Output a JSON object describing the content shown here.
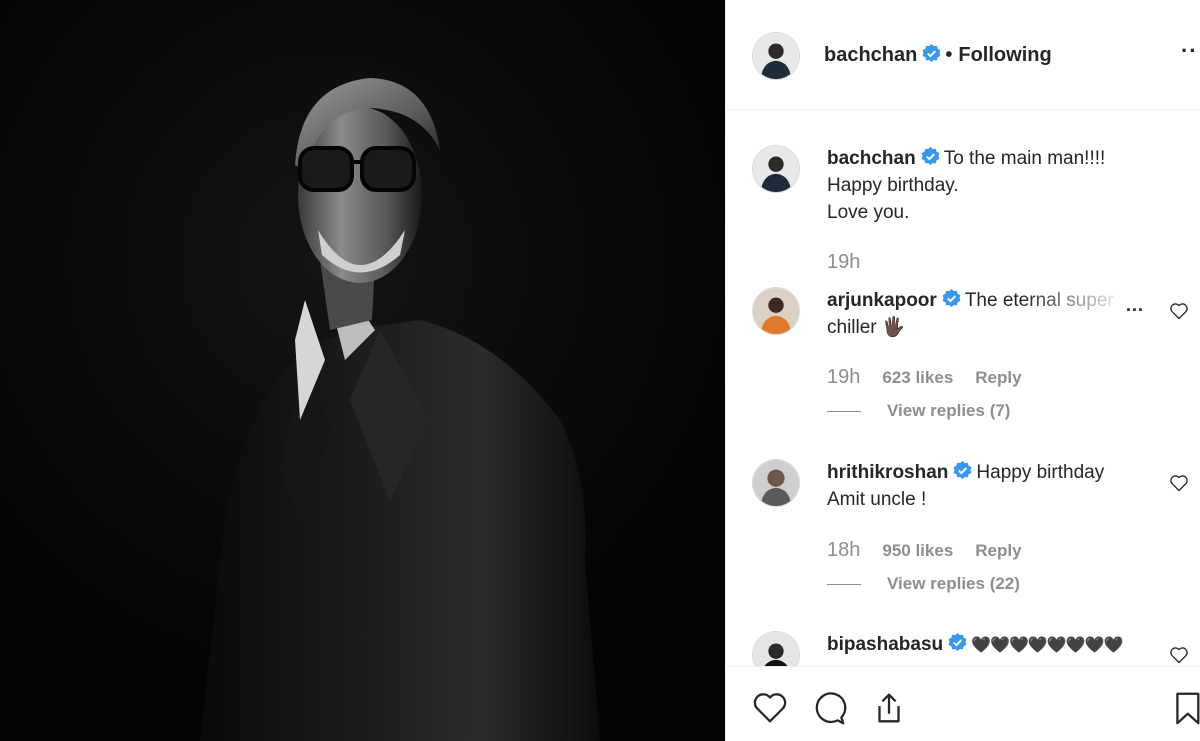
{
  "post": {
    "image_alt": "Black and white portrait of a man in glasses and a dark suit",
    "author": {
      "username": "bachchan",
      "verified": true,
      "separator": "•",
      "follow_status": "Following",
      "more_icon": "more-horizontal-icon"
    }
  },
  "comments": [
    {
      "username": "bachchan",
      "verified": true,
      "lines": [
        "To the main man!!!!",
        "Happy birthday.",
        "Love you."
      ],
      "time": "19h"
    },
    {
      "username": "arjunkapoor",
      "verified": true,
      "line1": "The eternal super",
      "line2": "chiller 🖐🏿",
      "more_label": "...",
      "time": "19h",
      "likes": "623 likes",
      "reply_label": "Reply",
      "view_replies": "View replies (7)"
    },
    {
      "username": "hrithikroshan",
      "verified": true,
      "line1": "Happy birthday",
      "line2": "Amit uncle !",
      "time": "18h",
      "likes": "950 likes",
      "reply_label": "Reply",
      "view_replies": "View replies (22)"
    },
    {
      "username": "bipashabasu",
      "verified": true,
      "line1": "🖤🖤🖤🖤🖤🖤🖤🖤"
    }
  ],
  "actions": {
    "like_icon": "heart-icon",
    "comment_icon": "comment-icon",
    "share_icon": "share-icon",
    "save_icon": "bookmark-icon"
  },
  "colors": {
    "text": "#262626",
    "muted": "#8e8e8e",
    "verified_blue": "#3897f0",
    "border": "#efefef"
  }
}
